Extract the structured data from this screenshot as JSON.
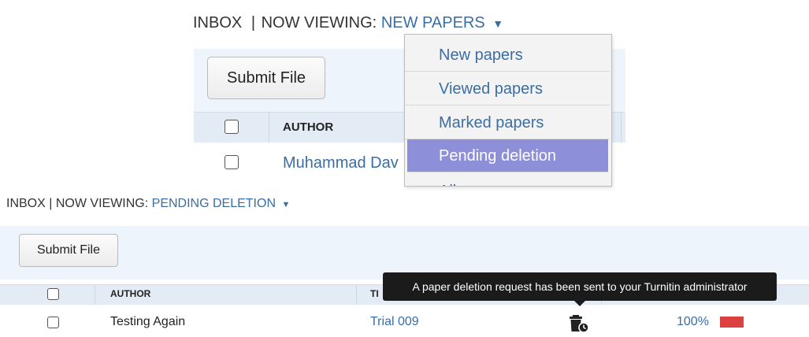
{
  "top_view": {
    "heading": {
      "inbox": "INBOX",
      "separator": "|",
      "now_viewing": "NOW VIEWING:",
      "current": "NEW PAPERS",
      "caret": "▼"
    },
    "submit_label": "Submit File",
    "columns": {
      "author": "AUTHOR"
    },
    "row": {
      "author": "Muhammad Dav"
    },
    "dropdown": {
      "items": [
        {
          "label": "New papers"
        },
        {
          "label": "Viewed papers"
        },
        {
          "label": "Marked papers"
        },
        {
          "label": "Pending deletion"
        },
        {
          "label": "All"
        }
      ],
      "selected": "Pending deletion"
    }
  },
  "bottom_view": {
    "heading": {
      "inbox": "INBOX",
      "separator": "|",
      "now_viewing": "NOW VIEWING:",
      "current": "PENDING DELETION",
      "caret": "▼"
    },
    "submit_label": "Submit File",
    "columns": {
      "author": "AUTHOR",
      "title": "TI"
    },
    "row": {
      "author": "Testing Again",
      "title": "Trial 009",
      "similarity": "100%",
      "status_icon": "trash-clock-icon"
    },
    "tooltip": "A paper deletion request has been sent to your Turnitin administrator"
  },
  "colors": {
    "link": "#3a6ea5",
    "panel": "#eef4fb",
    "header_row": "#e3ecf5",
    "dropdown_highlight": "#8e8fd9",
    "similarity_red": "#dd4040",
    "tooltip_bg": "#1b1b1b"
  }
}
